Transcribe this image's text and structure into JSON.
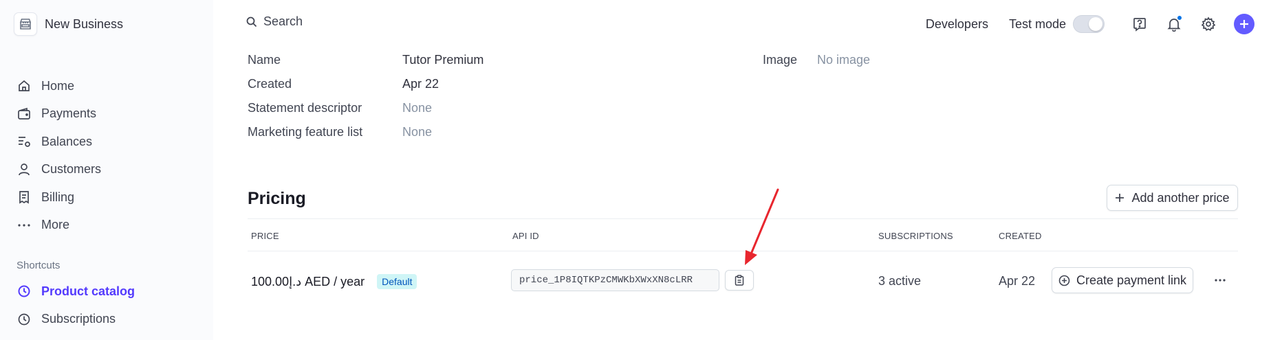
{
  "sidebar": {
    "business_name": "New Business",
    "nav": [
      {
        "label": "Home",
        "icon": "home-icon"
      },
      {
        "label": "Payments",
        "icon": "wallet-icon"
      },
      {
        "label": "Balances",
        "icon": "balances-icon"
      },
      {
        "label": "Customers",
        "icon": "person-icon"
      },
      {
        "label": "Billing",
        "icon": "billing-icon"
      },
      {
        "label": "More",
        "icon": "more-dots-icon"
      }
    ],
    "shortcuts_label": "Shortcuts",
    "shortcuts": [
      {
        "label": "Product catalog",
        "icon": "clock-icon",
        "active": true
      },
      {
        "label": "Subscriptions",
        "icon": "clock-icon",
        "active": false
      }
    ]
  },
  "topbar": {
    "search_placeholder": "Search",
    "developers": "Developers",
    "test_mode": "Test mode"
  },
  "details": {
    "rows": [
      {
        "label": "Name",
        "value": "Tutor Premium"
      },
      {
        "label": "Created",
        "value": "Apr 22"
      },
      {
        "label": "Statement descriptor",
        "value": "None"
      },
      {
        "label": "Marketing feature list",
        "value": "None"
      }
    ],
    "image_label": "Image",
    "image_value": "No image"
  },
  "pricing": {
    "title": "Pricing",
    "add_price": "Add another price",
    "columns": {
      "price": "PRICE",
      "api_id": "API ID",
      "subscriptions": "SUBSCRIPTIONS",
      "created": "CREATED"
    },
    "row": {
      "price": "100.00د.إ AED / year",
      "badge": "Default",
      "api_id": "price_1P8IQTKPzCMWKbXWxXN8cLRR",
      "subscriptions": "3 active",
      "created": "Apr 22",
      "create_link": "Create payment link"
    }
  },
  "colors": {
    "accent": "#635bff",
    "active_nav": "#533afd",
    "annotation_arrow": "#e8262e"
  }
}
